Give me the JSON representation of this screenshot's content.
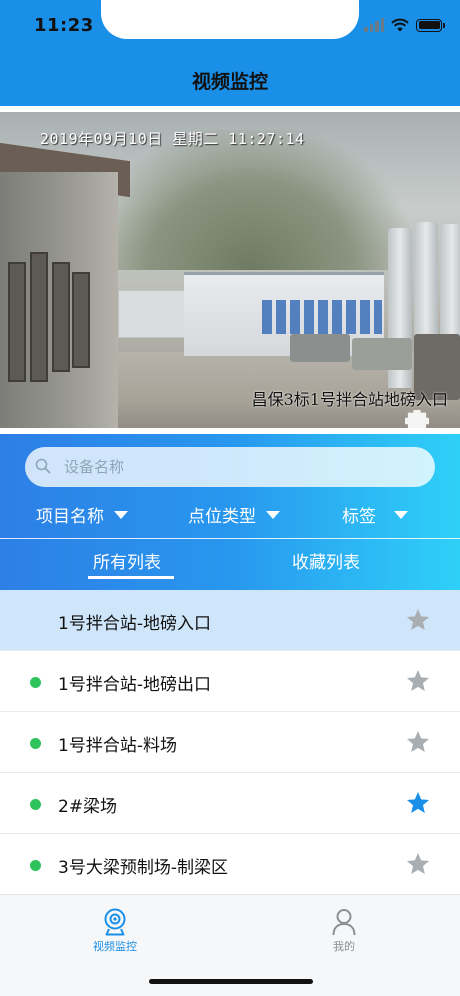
{
  "status_bar": {
    "time": "11:23"
  },
  "nav": {
    "title": "视频监控"
  },
  "video": {
    "osd_datetime": "2019年09月10日  星期二  11:27:14",
    "osd_location": "昌保3标1号拌合站地磅入口"
  },
  "search": {
    "placeholder": "设备名称"
  },
  "filters": [
    {
      "label": "项目名称"
    },
    {
      "label": "点位类型"
    },
    {
      "label": "标签"
    }
  ],
  "tabs": [
    {
      "label": "所有列表",
      "active": true
    },
    {
      "label": "收藏列表",
      "active": false
    }
  ],
  "devices": [
    {
      "label": "1号拌合站-地磅入口",
      "online": false,
      "selected": true,
      "favorite": false
    },
    {
      "label": "1号拌合站-地磅出口",
      "online": true,
      "selected": false,
      "favorite": false
    },
    {
      "label": "1号拌合站-料场",
      "online": true,
      "selected": false,
      "favorite": false
    },
    {
      "label": "2#梁场",
      "online": true,
      "selected": false,
      "favorite": true
    },
    {
      "label": "3号大梁预制场-制梁区",
      "online": true,
      "selected": false,
      "favorite": false
    }
  ],
  "tabbar": [
    {
      "label": "视频监控",
      "icon": "camera-icon",
      "active": true
    },
    {
      "label": "我的",
      "icon": "person-icon",
      "active": false
    }
  ],
  "colors": {
    "primary": "#1a8fe8",
    "online": "#2fc35c",
    "favorite": "#1a8fe8",
    "star_inactive": "#a9aeb3",
    "selected_row": "#cfe6fa"
  }
}
